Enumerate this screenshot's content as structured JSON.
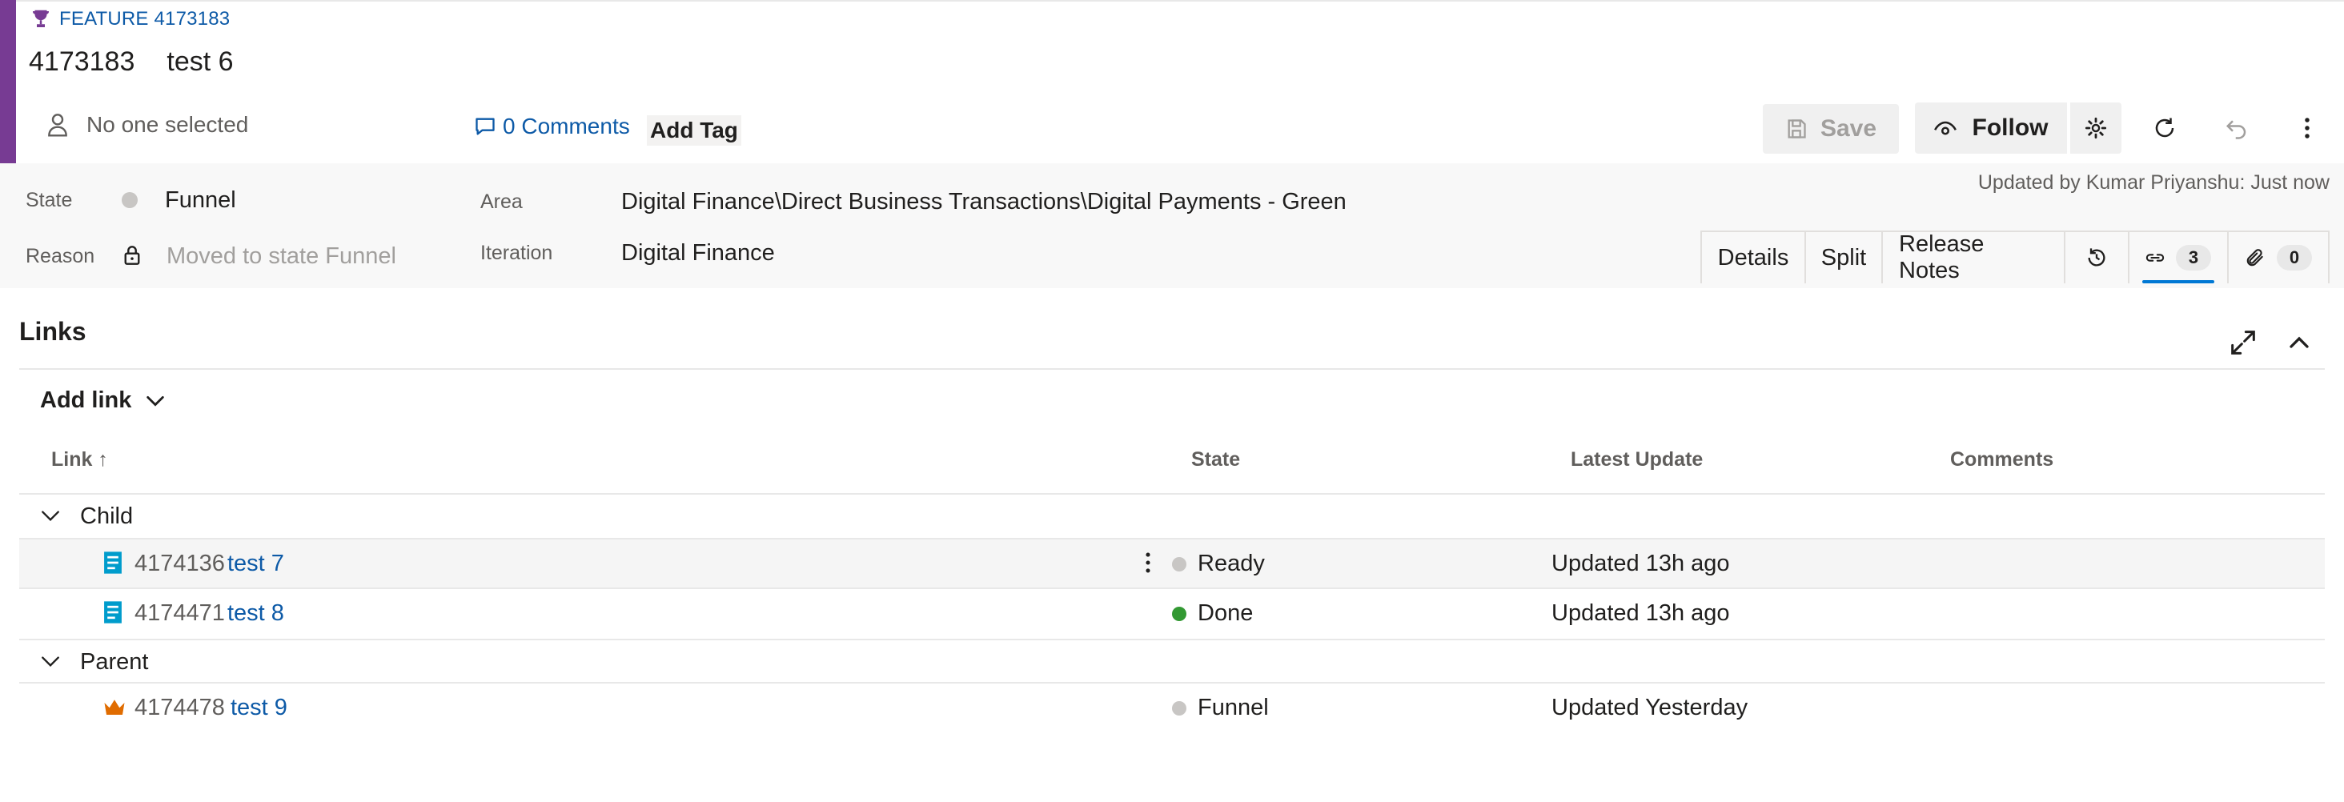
{
  "workitem": {
    "type_label": "FEATURE 4173183",
    "id": "4173183",
    "title": "test 6",
    "assignee": "No one selected",
    "comments_label": "0 Comments",
    "add_tag_label": "Add Tag"
  },
  "toolbar": {
    "save_label": "Save",
    "follow_label": "Follow"
  },
  "fields": {
    "state_label": "State",
    "state_value": "Funnel",
    "reason_label": "Reason",
    "reason_value": "Moved to state Funnel",
    "area_label": "Area",
    "area_value": "Digital Finance\\Direct Business Transactions\\Digital Payments - Green",
    "iteration_label": "Iteration",
    "iteration_value": "Digital Finance",
    "updated_by": "Updated by Kumar Priyanshu: Just now"
  },
  "tabs": {
    "details": "Details",
    "split": "Split",
    "release_notes": "Release Notes",
    "links_count": "3",
    "attachments_count": "0"
  },
  "links": {
    "title": "Links",
    "add_link_label": "Add link",
    "columns": {
      "link": "Link ↑",
      "state": "State",
      "latest_update": "Latest Update",
      "comments": "Comments"
    },
    "groups": [
      {
        "name": "Child",
        "rows": [
          {
            "id": "4174136",
            "title": "test 7",
            "state": "Ready",
            "state_color": "#c8c6c4",
            "updated": "Updated 13h ago",
            "icon": "user-story-icon"
          },
          {
            "id": "4174471",
            "title": "test 8",
            "state": "Done",
            "state_color": "#339933",
            "updated": "Updated 13h ago",
            "icon": "user-story-icon"
          }
        ]
      },
      {
        "name": "Parent",
        "rows": [
          {
            "id": "4174478",
            "title": "test 9",
            "state": "Funnel",
            "state_color": "#c8c6c4",
            "updated": "Updated Yesterday",
            "icon": "epic-crown-icon"
          }
        ]
      }
    ]
  },
  "colors": {
    "accent": "#773b93",
    "link": "#0d5aa7",
    "tab_active": "#0078d4",
    "done_green": "#339933",
    "neutral_dot": "#c8c6c4",
    "story_blue": "#009ccc",
    "epic_orange": "#e06c00"
  }
}
